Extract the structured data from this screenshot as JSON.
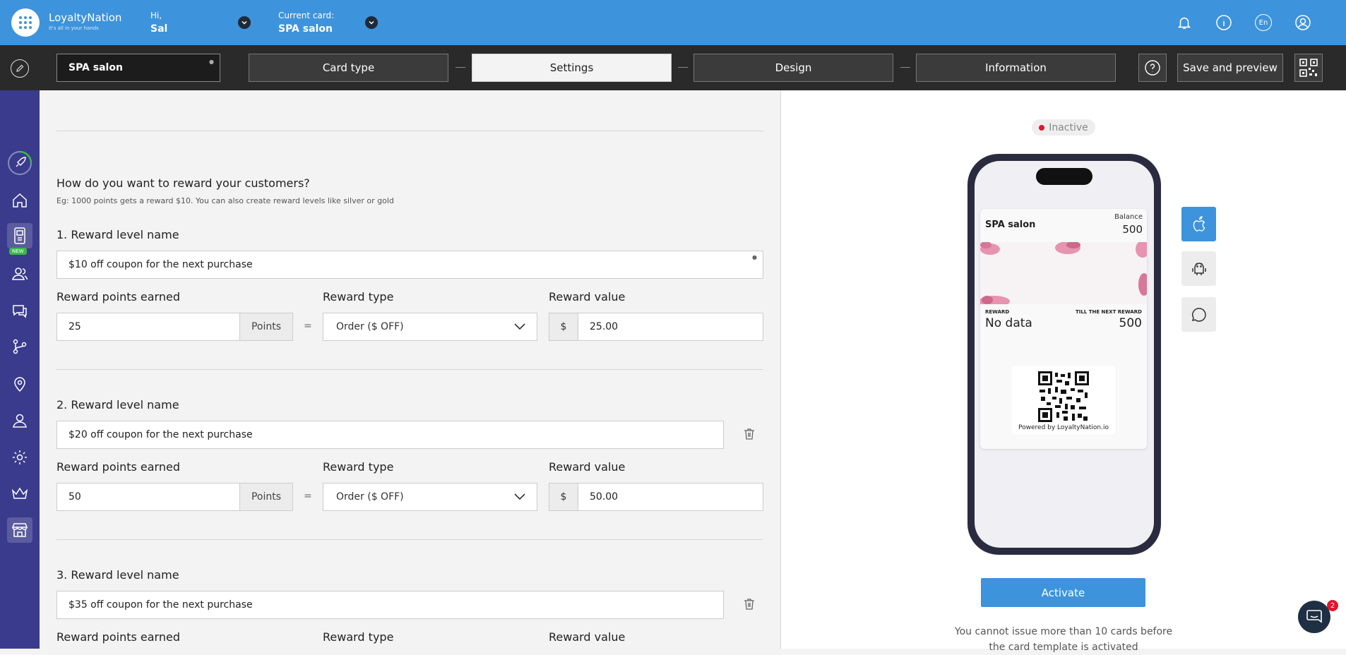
{
  "header": {
    "brand": "LoyaltyNation",
    "brand_tagline": "It's all in your hands",
    "greeting": "Hi,",
    "user_name": "Sal",
    "current_card_label": "Current card:",
    "current_card_name": "SPA salon",
    "language": "En"
  },
  "toolbar": {
    "card_name": "SPA salon",
    "steps": [
      "Card type",
      "Settings",
      "Design",
      "Information"
    ],
    "active_step": "Settings",
    "help_label": "?",
    "save_label": "Save and preview"
  },
  "form": {
    "question": "How do you want to reward your customers?",
    "question_hint": "Eg: 1000 points gets a reward $10. You can also create reward levels like silver or gold",
    "levels": [
      {
        "label": "1. Reward level name",
        "name": "$10 off coupon for the next purchase",
        "points_label": "Reward points earned",
        "points": "25",
        "unit": "Points",
        "eq": "=",
        "type_label": "Reward type",
        "type": "Order ($ OFF)",
        "value_label": "Reward value",
        "currency": "$",
        "value": "25.00"
      },
      {
        "label": "2. Reward level name",
        "name": "$20 off coupon for the next purchase",
        "points_label": "Reward points earned",
        "points": "50",
        "unit": "Points",
        "eq": "=",
        "type_label": "Reward type",
        "type": "Order ($ OFF)",
        "value_label": "Reward value",
        "currency": "$",
        "value": "50.00"
      },
      {
        "label": "3. Reward level name",
        "name": "$35 off coupon for the next purchase",
        "points_label": "Reward points earned",
        "type_label": "Reward type",
        "value_label": "Reward value"
      }
    ]
  },
  "preview": {
    "status": "Inactive",
    "status_color": "#e0162b",
    "card_name": "SPA salon",
    "balance_label": "Balance",
    "balance_value": "500",
    "reward_label": "REWARD",
    "reward_value": "No data",
    "next_label": "TILL THE NEXT REWARD",
    "next_value": "500",
    "powered_by": "Powered by LoyaltyNation.io",
    "activate_label": "Activate",
    "notice": "You cannot issue more than 10 cards before the card template is activated"
  },
  "chat": {
    "badge": "2"
  },
  "colors": {
    "accent": "#3d93dc",
    "sidebar": "#3a3b8c",
    "toolbar": "#2a2a2a"
  }
}
